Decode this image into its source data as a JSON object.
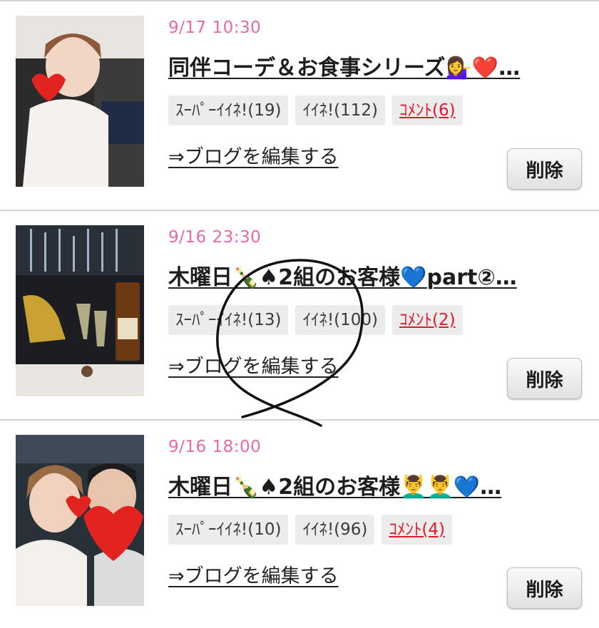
{
  "entries": [
    {
      "date": "9/17 10:30",
      "title": "同伴コーデ＆お食事シリーズ💁‍♀️❤️…",
      "super_like": "ｽｰﾊﾟｰｲｲﾈ!(19)",
      "like": "ｲｲﾈ!(112)",
      "comment": "ｺﾒﾝﾄ(6)",
      "edit_link": "⇒ブログを編集する",
      "delete_label": "削除"
    },
    {
      "date": "9/16 23:30",
      "title": "木曜日🍾♠2組のお客様💙part②…",
      "super_like": "ｽｰﾊﾟｰｲｲﾈ!(13)",
      "like": "ｲｲﾈ!(100)",
      "comment": "ｺﾒﾝﾄ(2)",
      "edit_link": "⇒ブログを編集する",
      "delete_label": "削除"
    },
    {
      "date": "9/16 18:00",
      "title": "木曜日🍾♠2組のお客様💆‍♂️💆‍♂️💙…",
      "super_like": "ｽｰﾊﾟｰｲｲﾈ!(10)",
      "like": "ｲｲﾈ!(96)",
      "comment": "ｺﾒﾝﾄ(4)",
      "edit_link": "⇒ブログを編集する",
      "delete_label": "削除"
    }
  ],
  "colors": {
    "date": "#e66aa7",
    "comment": "#e0192b",
    "badge_bg": "#ececec",
    "separator": "#d4d4d4"
  }
}
